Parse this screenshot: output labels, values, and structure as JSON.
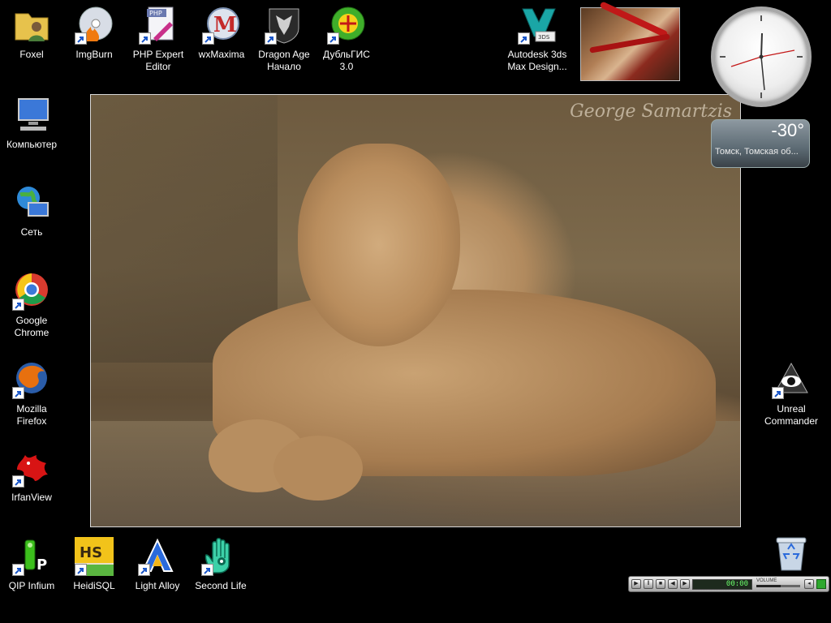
{
  "desktop": {
    "icons": [
      {
        "label": "Foxel"
      },
      {
        "label": "ImgBurn"
      },
      {
        "label": "PHP Expert\nEditor"
      },
      {
        "label": "wxMaxima"
      },
      {
        "label": "Dragon Age\nНачало"
      },
      {
        "label": "ДубльГИС\n3.0"
      },
      {
        "label": "Autodesk 3ds\nMax Design..."
      },
      {
        "label": "Компьютер"
      },
      {
        "label": "Сеть"
      },
      {
        "label": "Google\nChrome"
      },
      {
        "label": "Mozilla\nFirefox"
      },
      {
        "label": "IrfanView"
      },
      {
        "label": "QIP Infium"
      },
      {
        "label": "HeidiSQL"
      },
      {
        "label": "Light Alloy"
      },
      {
        "label": "Second Life"
      },
      {
        "label": "Unreal\nCommander"
      },
      {
        "label": ""
      }
    ],
    "icon_badges": {
      "heidisql": "HS",
      "php_editor": "PHP",
      "max_design": "3DS"
    }
  },
  "wallpaper": {
    "signature": "George Samartzis"
  },
  "weather_gadget": {
    "temperature": "-30°",
    "location": "Томск, Томская об..."
  },
  "media_player": {
    "time": "00:00",
    "volume_label": "VOLUME",
    "volume_level": 0.55
  },
  "colors": {
    "background": "#000000",
    "label_text": "#ffffff",
    "lcd_text": "#6cff6c"
  }
}
